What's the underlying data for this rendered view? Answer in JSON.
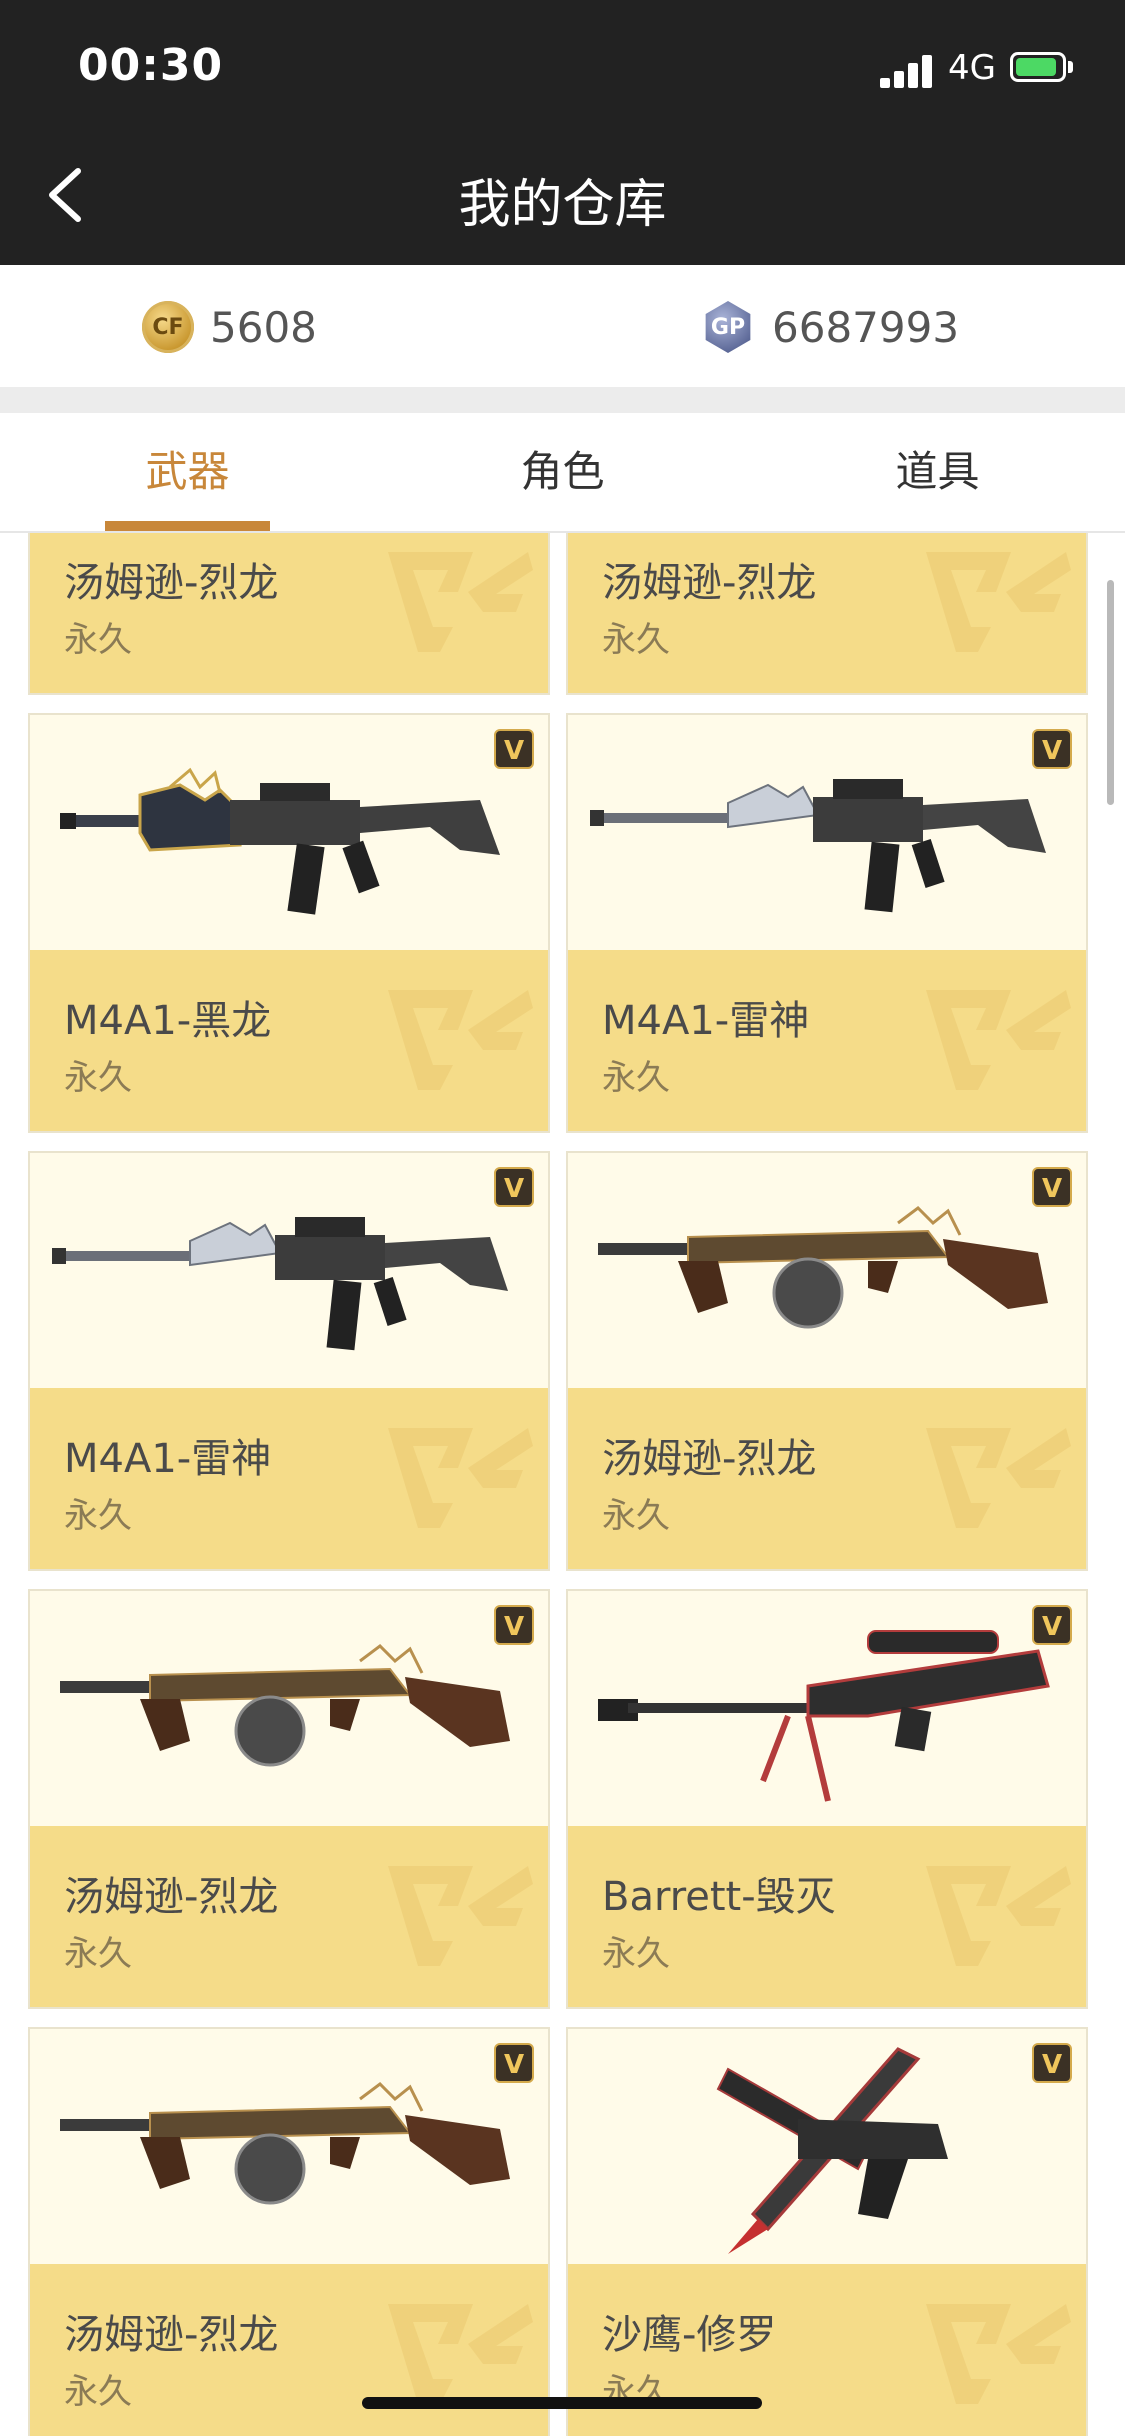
{
  "status_bar": {
    "time": "00:30",
    "network": "4G"
  },
  "header": {
    "title": "我的仓库"
  },
  "currency": {
    "cf_points": "5608",
    "gp": "6687993",
    "cf_label": "CF",
    "gp_label": "GP"
  },
  "tabs": [
    {
      "label": "武器",
      "active": true
    },
    {
      "label": "角色",
      "active": false
    },
    {
      "label": "道具",
      "active": false
    }
  ],
  "items": [
    {
      "name": "汤姆逊-烈龙",
      "duration": "永久",
      "weapon": "none",
      "vip": false
    },
    {
      "name": "汤姆逊-烈龙",
      "duration": "永久",
      "weapon": "none",
      "vip": false
    },
    {
      "name": "M4A1-黑龙",
      "duration": "永久",
      "weapon": "rifle-black-dragon",
      "vip": true
    },
    {
      "name": "M4A1-雷神",
      "duration": "永久",
      "weapon": "rifle-thor",
      "vip": true
    },
    {
      "name": "M4A1-雷神",
      "duration": "永久",
      "weapon": "rifle-thor",
      "vip": true
    },
    {
      "name": "汤姆逊-烈龙",
      "duration": "永久",
      "weapon": "smg-thompson",
      "vip": true
    },
    {
      "name": "汤姆逊-烈龙",
      "duration": "永久",
      "weapon": "smg-thompson",
      "vip": true
    },
    {
      "name": "Barrett-毁灭",
      "duration": "永久",
      "weapon": "sniper-barrett",
      "vip": true
    },
    {
      "name": "汤姆逊-烈龙",
      "duration": "永久",
      "weapon": "smg-thompson",
      "vip": true
    },
    {
      "name": "沙鹰-修罗",
      "duration": "永久",
      "weapon": "pistol-deagle",
      "vip": true
    }
  ],
  "vip_badge_text": "V",
  "colors": {
    "accent": "#c8873a",
    "card_info_bg": "#f5dc89",
    "card_img_bg": "#fffbe9",
    "header_bg": "#222222"
  }
}
